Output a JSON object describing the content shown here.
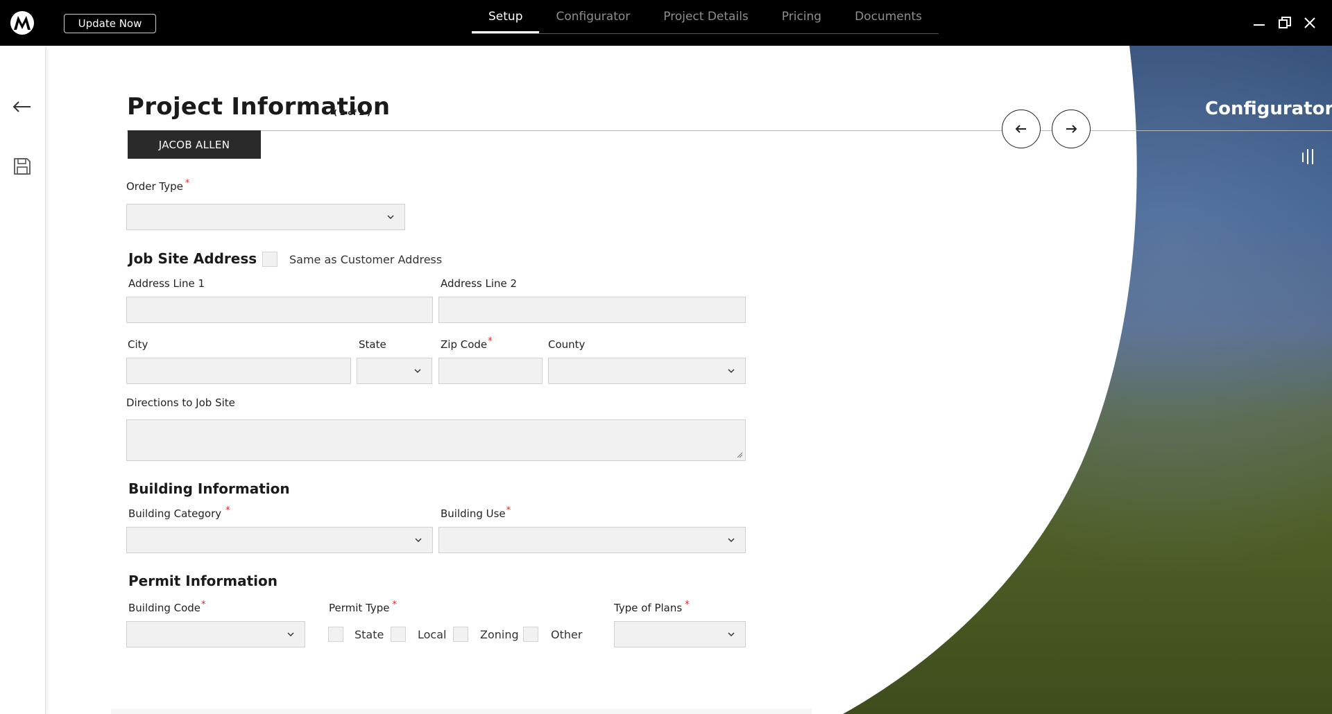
{
  "topbar": {
    "update_label": "Update Now",
    "tabs": [
      {
        "label": "Setup",
        "active": true
      },
      {
        "label": "Configurator",
        "active": false
      },
      {
        "label": "Project Details",
        "active": false
      },
      {
        "label": "Pricing",
        "active": false
      },
      {
        "label": "Documents",
        "active": false
      }
    ]
  },
  "page": {
    "title": "Project Information",
    "step": "( 2 of 2 )",
    "customer_name": "JACOB ALLEN",
    "right_panel_title": "Configurator"
  },
  "form": {
    "order_type": {
      "label": "Order Type",
      "value": "",
      "required": true
    },
    "job_site": {
      "heading": "Job Site Address",
      "same_as_customer_label": "Same as Customer Address",
      "same_as_customer_checked": false,
      "address_line1": {
        "label": "Address Line 1",
        "value": ""
      },
      "address_line2": {
        "label": "Address Line 2",
        "value": ""
      },
      "city": {
        "label": "City",
        "value": ""
      },
      "state": {
        "label": "State",
        "value": ""
      },
      "zip": {
        "label": "Zip Code",
        "value": "",
        "required": true
      },
      "county": {
        "label": "County",
        "value": ""
      },
      "directions": {
        "label": "Directions to Job Site",
        "value": ""
      }
    },
    "building": {
      "heading": "Building Information",
      "category": {
        "label": "Building Category",
        "value": "",
        "required": true
      },
      "use": {
        "label": "Building Use",
        "value": "",
        "required": true
      }
    },
    "permit": {
      "heading": "Permit Information",
      "building_code": {
        "label": "Building Code",
        "value": "",
        "required": true
      },
      "permit_type_label": "Permit Type",
      "permit_options": [
        {
          "label": "State",
          "checked": false
        },
        {
          "label": "Local",
          "checked": false
        },
        {
          "label": "Zoning",
          "checked": false
        },
        {
          "label": "Other",
          "checked": false
        }
      ],
      "type_of_plans": {
        "label": "Type of Plans",
        "value": "",
        "required": true
      }
    },
    "required_marker": "*"
  },
  "colors": {
    "topbar": "#000000",
    "accent_required": "#e0262b",
    "field_bg": "#f1f1f1",
    "sky": "#3b5d8c",
    "grass": "#4e5d24"
  }
}
